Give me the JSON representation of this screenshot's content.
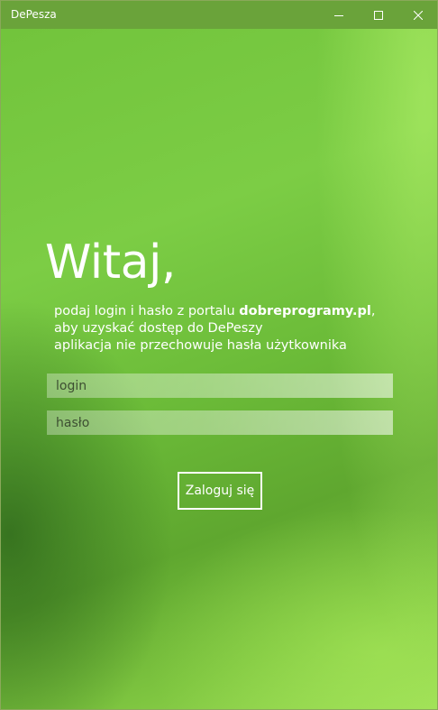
{
  "window": {
    "title": "DePesza",
    "controls": {
      "minimize": "minimize-icon",
      "maximize": "maximize-icon",
      "close": "close-icon"
    }
  },
  "login": {
    "heading": "Witaj,",
    "desc_prefix": "podaj login i hasło z portalu ",
    "desc_site": "dobreprogramy.pl",
    "desc_suffix": ", aby uzyskać dostęp do DePeszy",
    "note": "aplikacja nie przechowuje hasła użytkownika",
    "login_placeholder": "login",
    "password_placeholder": "hasło",
    "submit_label": "Zaloguj się"
  },
  "colors": {
    "titlebar": "#6aa33a",
    "background_primary": "#72c43c",
    "background_dark": "#3f7a25",
    "text": "#ffffff"
  }
}
